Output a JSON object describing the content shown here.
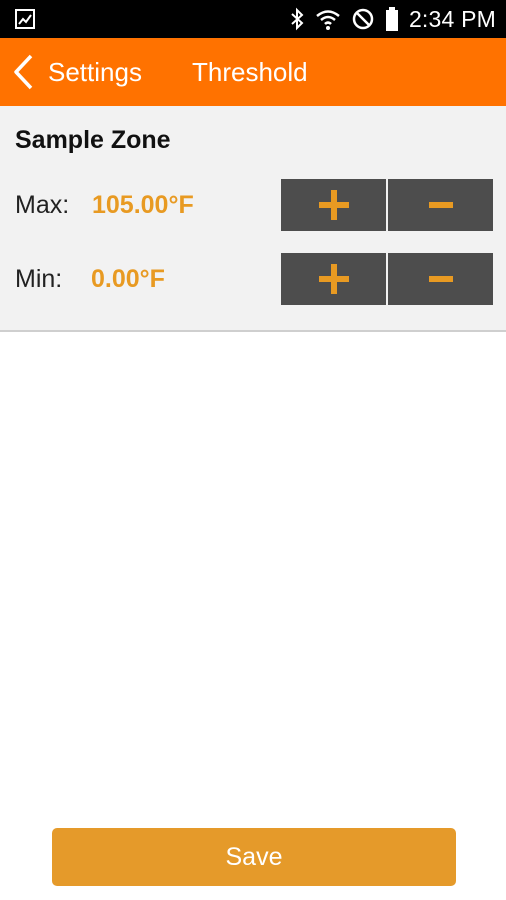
{
  "status_bar": {
    "time": "2:34 PM",
    "icons": [
      "image-notification-icon",
      "bluetooth-icon",
      "wifi-icon",
      "do-not-disturb-icon",
      "battery-icon"
    ]
  },
  "header": {
    "back_label": "Settings",
    "title": "Threshold"
  },
  "zone": {
    "title": "Sample Zone",
    "max": {
      "label": "Max:",
      "value": "105.00°F"
    },
    "min": {
      "label": "Min:",
      "value": "0.00°F"
    }
  },
  "actions": {
    "save_label": "Save"
  },
  "colors": {
    "header_bg": "#ff7200",
    "accent": "#e89a22",
    "button_dark": "#4d4d4d",
    "save_bg": "#e59a2a"
  }
}
